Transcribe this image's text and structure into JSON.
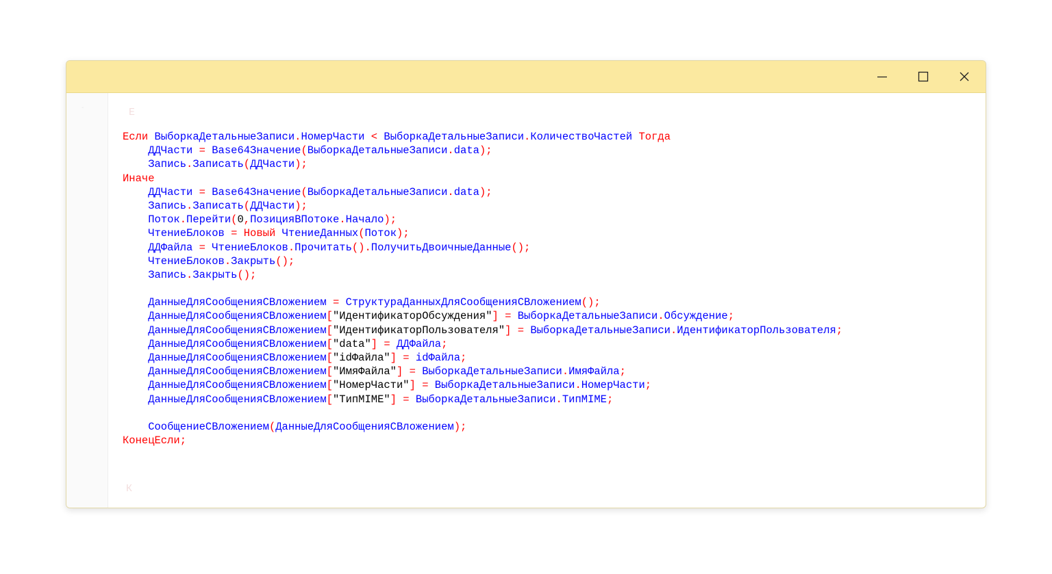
{
  "window": {
    "title": "",
    "controls": {
      "minimize": "minimize",
      "maximize": "maximize",
      "close": "close"
    }
  },
  "faint_text": {
    "top": "Е",
    "bottom": "К"
  },
  "code_lines": [
    [
      {
        "t": "kw",
        "v": "Если"
      },
      {
        "t": "id",
        "v": " ВыборкаДетальныеЗаписи"
      },
      {
        "t": "op",
        "v": "."
      },
      {
        "t": "id",
        "v": "НомерЧасти "
      },
      {
        "t": "op",
        "v": "<"
      },
      {
        "t": "id",
        "v": " ВыборкаДетальныеЗаписи"
      },
      {
        "t": "op",
        "v": "."
      },
      {
        "t": "id",
        "v": "КоличествоЧастей "
      },
      {
        "t": "kw",
        "v": "Тогда"
      }
    ],
    [
      {
        "t": "id",
        "v": "    ДДЧасти "
      },
      {
        "t": "op",
        "v": "="
      },
      {
        "t": "id",
        "v": " Base64Значение"
      },
      {
        "t": "op",
        "v": "("
      },
      {
        "t": "id",
        "v": "ВыборкаДетальныеЗаписи"
      },
      {
        "t": "op",
        "v": "."
      },
      {
        "t": "id",
        "v": "data"
      },
      {
        "t": "op",
        "v": ");"
      }
    ],
    [
      {
        "t": "id",
        "v": "    Запись"
      },
      {
        "t": "op",
        "v": "."
      },
      {
        "t": "id",
        "v": "Записать"
      },
      {
        "t": "op",
        "v": "("
      },
      {
        "t": "id",
        "v": "ДДЧасти"
      },
      {
        "t": "op",
        "v": ");"
      }
    ],
    [
      {
        "t": "kw",
        "v": "Иначе"
      }
    ],
    [
      {
        "t": "id",
        "v": "    ДДЧасти "
      },
      {
        "t": "op",
        "v": "="
      },
      {
        "t": "id",
        "v": " Base64Значение"
      },
      {
        "t": "op",
        "v": "("
      },
      {
        "t": "id",
        "v": "ВыборкаДетальныеЗаписи"
      },
      {
        "t": "op",
        "v": "."
      },
      {
        "t": "id",
        "v": "data"
      },
      {
        "t": "op",
        "v": ");"
      }
    ],
    [
      {
        "t": "id",
        "v": "    Запись"
      },
      {
        "t": "op",
        "v": "."
      },
      {
        "t": "id",
        "v": "Записать"
      },
      {
        "t": "op",
        "v": "("
      },
      {
        "t": "id",
        "v": "ДДЧасти"
      },
      {
        "t": "op",
        "v": ");"
      }
    ],
    [
      {
        "t": "id",
        "v": "    Поток"
      },
      {
        "t": "op",
        "v": "."
      },
      {
        "t": "id",
        "v": "Перейти"
      },
      {
        "t": "op",
        "v": "("
      },
      {
        "t": "str",
        "v": "0"
      },
      {
        "t": "op",
        "v": ","
      },
      {
        "t": "id",
        "v": "ПозицияВПотоке"
      },
      {
        "t": "op",
        "v": "."
      },
      {
        "t": "id",
        "v": "Начало"
      },
      {
        "t": "op",
        "v": ");"
      }
    ],
    [
      {
        "t": "id",
        "v": "    ЧтениеБлоков "
      },
      {
        "t": "op",
        "v": "="
      },
      {
        "t": "kw",
        "v": " Новый"
      },
      {
        "t": "id",
        "v": " ЧтениеДанных"
      },
      {
        "t": "op",
        "v": "("
      },
      {
        "t": "id",
        "v": "Поток"
      },
      {
        "t": "op",
        "v": ");"
      }
    ],
    [
      {
        "t": "id",
        "v": "    ДДФайла "
      },
      {
        "t": "op",
        "v": "="
      },
      {
        "t": "id",
        "v": " ЧтениеБлоков"
      },
      {
        "t": "op",
        "v": "."
      },
      {
        "t": "id",
        "v": "Прочитать"
      },
      {
        "t": "op",
        "v": "()."
      },
      {
        "t": "id",
        "v": "ПолучитьДвоичныеДанные"
      },
      {
        "t": "op",
        "v": "();"
      }
    ],
    [
      {
        "t": "id",
        "v": "    ЧтениеБлоков"
      },
      {
        "t": "op",
        "v": "."
      },
      {
        "t": "id",
        "v": "Закрыть"
      },
      {
        "t": "op",
        "v": "();"
      }
    ],
    [
      {
        "t": "id",
        "v": "    Запись"
      },
      {
        "t": "op",
        "v": "."
      },
      {
        "t": "id",
        "v": "Закрыть"
      },
      {
        "t": "op",
        "v": "();"
      }
    ],
    [],
    [
      {
        "t": "id",
        "v": "    ДанныеДляСообщенияСВложением "
      },
      {
        "t": "op",
        "v": "="
      },
      {
        "t": "id",
        "v": " СтруктураДанныхДляСообщенияСВложением"
      },
      {
        "t": "op",
        "v": "();"
      }
    ],
    [
      {
        "t": "id",
        "v": "    ДанныеДляСообщенияСВложением"
      },
      {
        "t": "op",
        "v": "["
      },
      {
        "t": "str",
        "v": "\"ИдентификаторОбсуждения\""
      },
      {
        "t": "op",
        "v": "] ="
      },
      {
        "t": "id",
        "v": " ВыборкаДетальныеЗаписи"
      },
      {
        "t": "op",
        "v": "."
      },
      {
        "t": "id",
        "v": "Обсуждение"
      },
      {
        "t": "op",
        "v": ";"
      }
    ],
    [
      {
        "t": "id",
        "v": "    ДанныеДляСообщенияСВложением"
      },
      {
        "t": "op",
        "v": "["
      },
      {
        "t": "str",
        "v": "\"ИдентификаторПользователя\""
      },
      {
        "t": "op",
        "v": "] ="
      },
      {
        "t": "id",
        "v": " ВыборкаДетальныеЗаписи"
      },
      {
        "t": "op",
        "v": "."
      },
      {
        "t": "id",
        "v": "ИдентификаторПользователя"
      },
      {
        "t": "op",
        "v": ";"
      }
    ],
    [
      {
        "t": "id",
        "v": "    ДанныеДляСообщенияСВложением"
      },
      {
        "t": "op",
        "v": "["
      },
      {
        "t": "str",
        "v": "\"data\""
      },
      {
        "t": "op",
        "v": "] ="
      },
      {
        "t": "id",
        "v": " ДДФайла"
      },
      {
        "t": "op",
        "v": ";"
      }
    ],
    [
      {
        "t": "id",
        "v": "    ДанныеДляСообщенияСВложением"
      },
      {
        "t": "op",
        "v": "["
      },
      {
        "t": "str",
        "v": "\"idФайла\""
      },
      {
        "t": "op",
        "v": "] ="
      },
      {
        "t": "id",
        "v": " idФайла"
      },
      {
        "t": "op",
        "v": ";"
      }
    ],
    [
      {
        "t": "id",
        "v": "    ДанныеДляСообщенияСВложением"
      },
      {
        "t": "op",
        "v": "["
      },
      {
        "t": "str",
        "v": "\"ИмяФайла\""
      },
      {
        "t": "op",
        "v": "] ="
      },
      {
        "t": "id",
        "v": " ВыборкаДетальныеЗаписи"
      },
      {
        "t": "op",
        "v": "."
      },
      {
        "t": "id",
        "v": "ИмяФайла"
      },
      {
        "t": "op",
        "v": ";"
      }
    ],
    [
      {
        "t": "id",
        "v": "    ДанныеДляСообщенияСВложением"
      },
      {
        "t": "op",
        "v": "["
      },
      {
        "t": "str",
        "v": "\"НомерЧасти\""
      },
      {
        "t": "op",
        "v": "] ="
      },
      {
        "t": "id",
        "v": " ВыборкаДетальныеЗаписи"
      },
      {
        "t": "op",
        "v": "."
      },
      {
        "t": "id",
        "v": "НомерЧасти"
      },
      {
        "t": "op",
        "v": ";"
      }
    ],
    [
      {
        "t": "id",
        "v": "    ДанныеДляСообщенияСВложением"
      },
      {
        "t": "op",
        "v": "["
      },
      {
        "t": "str",
        "v": "\"ТипMIME\""
      },
      {
        "t": "op",
        "v": "] ="
      },
      {
        "t": "id",
        "v": " ВыборкаДетальныеЗаписи"
      },
      {
        "t": "op",
        "v": "."
      },
      {
        "t": "id",
        "v": "ТипMIME"
      },
      {
        "t": "op",
        "v": ";"
      }
    ],
    [],
    [
      {
        "t": "id",
        "v": "    СообщениеСВложением"
      },
      {
        "t": "op",
        "v": "("
      },
      {
        "t": "id",
        "v": "ДанныеДляСообщенияСВложением"
      },
      {
        "t": "op",
        "v": ");"
      }
    ],
    [
      {
        "t": "kw",
        "v": "КонецЕсли"
      },
      {
        "t": "op",
        "v": ";"
      }
    ]
  ],
  "colors": {
    "titlebar": "#fbe9a0",
    "keyword": "#ff0000",
    "identifier": "#0000ff",
    "string": "#000000"
  }
}
